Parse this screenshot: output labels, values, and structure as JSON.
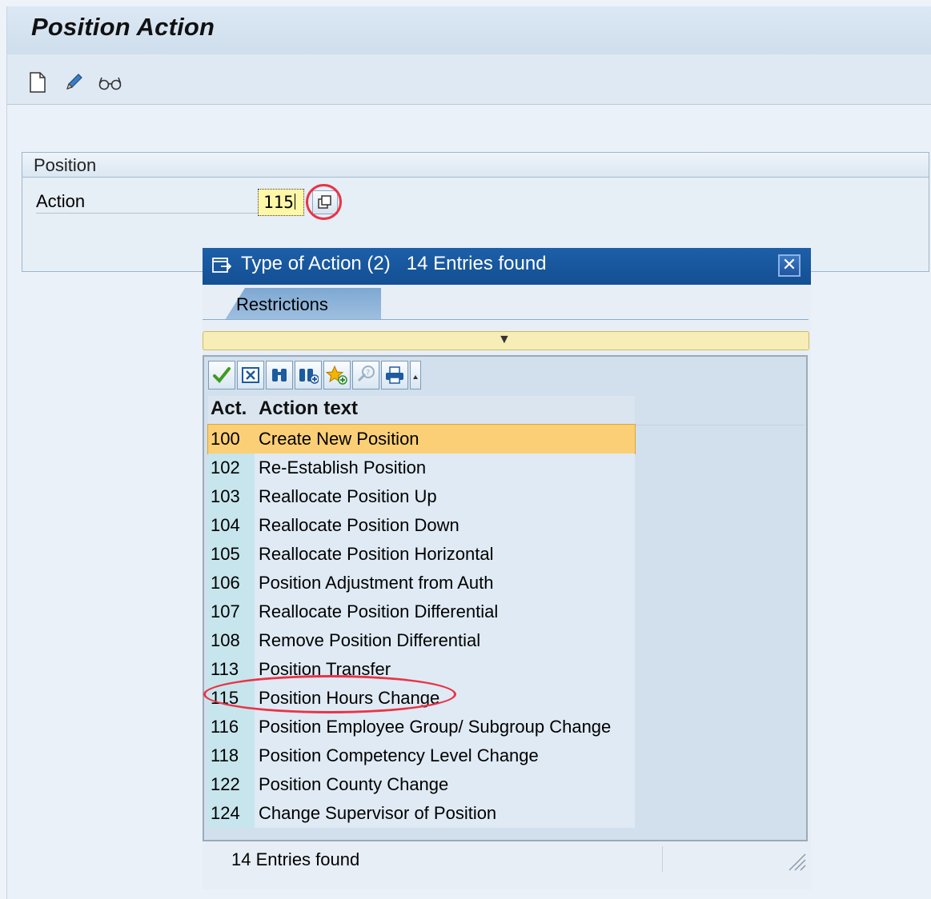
{
  "window": {
    "title": "Position Action",
    "toolbar": {
      "icons": [
        "new-document-icon",
        "edit-pencil-icon",
        "display-glasses-icon"
      ]
    }
  },
  "position_panel": {
    "title": "Position",
    "field_label": "Action",
    "field_value": "115"
  },
  "dialog": {
    "title": "Type of Action (2)   14 Entries found",
    "tab_label": "Restrictions",
    "columns": {
      "act": "Act.",
      "text": "Action text"
    },
    "rows": [
      {
        "act": "100",
        "text": "Create New Position"
      },
      {
        "act": "102",
        "text": "Re-Establish Position"
      },
      {
        "act": "103",
        "text": "Reallocate Position Up"
      },
      {
        "act": "104",
        "text": "Reallocate Position Down"
      },
      {
        "act": "105",
        "text": "Reallocate Position Horizontal"
      },
      {
        "act": "106",
        "text": "Position Adjustment from Auth"
      },
      {
        "act": "107",
        "text": "Reallocate Position Differential"
      },
      {
        "act": "108",
        "text": "Remove Position Differential"
      },
      {
        "act": "113",
        "text": "Position Transfer"
      },
      {
        "act": "115",
        "text": "Position Hours Change"
      },
      {
        "act": "116",
        "text": "Position Employee Group/ Subgroup Change"
      },
      {
        "act": "118",
        "text": "Position Competency Level Change"
      },
      {
        "act": "122",
        "text": "Position County Change"
      },
      {
        "act": "124",
        "text": "Change Supervisor of Position"
      }
    ],
    "status": "14 Entries found",
    "toolbar_icons": [
      "check-icon",
      "cancel-icon",
      "find-icon",
      "find-next-icon",
      "favorites-add-icon",
      "help-icon",
      "print-icon",
      "more-arrow-icon"
    ]
  },
  "colors": {
    "title_bar": "#1d5fa8",
    "selected_row": "#fbcf76",
    "highlight_circle": "#ea3346",
    "input_bg": "#fff7a8"
  }
}
